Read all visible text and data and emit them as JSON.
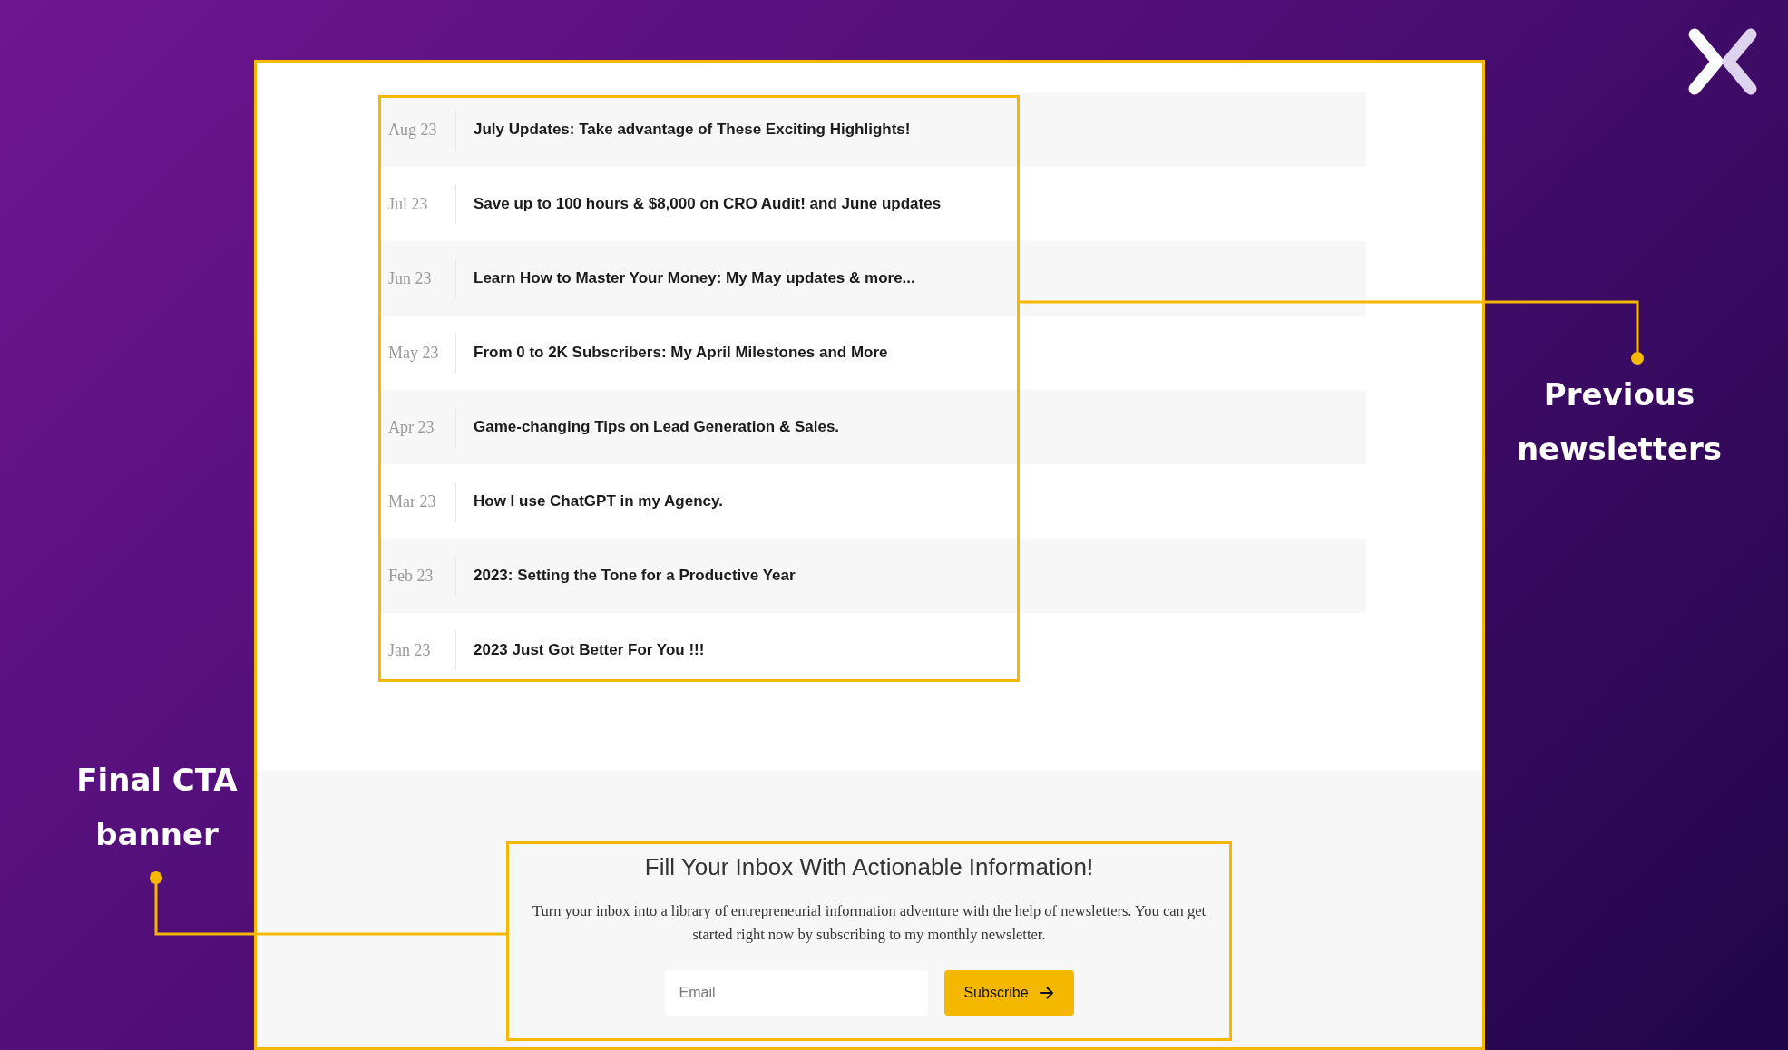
{
  "newsletters": [
    {
      "date": "Aug 23",
      "title": "July Updates: Take advantage of These Exciting Highlights!"
    },
    {
      "date": "Jul 23",
      "title": "Save up to 100 hours & $8,000 on CRO Audit! and June updates"
    },
    {
      "date": "Jun 23",
      "title": "Learn How to Master Your Money: My May updates & more..."
    },
    {
      "date": "May 23",
      "title": "From 0 to 2K Subscribers: My April Milestones and More"
    },
    {
      "date": "Apr 23",
      "title": "Game-changing Tips on Lead Generation & Sales."
    },
    {
      "date": "Mar 23",
      "title": "How I use ChatGPT in my Agency."
    },
    {
      "date": "Feb 23",
      "title": "2023: Setting the Tone for a Productive Year"
    },
    {
      "date": "Jan 23",
      "title": "2023 Just Got Better For You !!!"
    }
  ],
  "cta": {
    "heading": "Fill Your Inbox With Actionable Information!",
    "text": "Turn your inbox into a library of entrepreneurial information adventure with the help of newsletters. You can get started right now by subscribing to my monthly newsletter.",
    "email": {
      "placeholder": "Email"
    },
    "button": "Subscribe"
  },
  "annotations": [
    {
      "label": "Previous newsletters"
    },
    {
      "label": "Final CTA banner"
    }
  ]
}
